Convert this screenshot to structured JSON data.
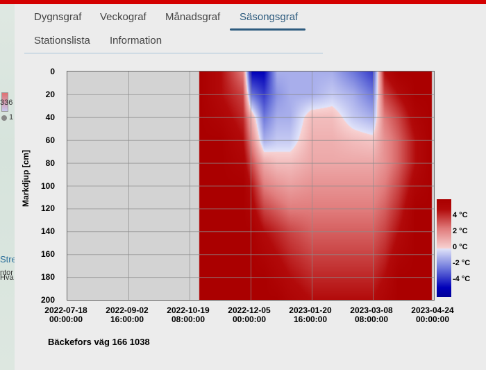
{
  "tabs": [
    {
      "label": "Dygnsgraf",
      "active": false
    },
    {
      "label": "Veckograf",
      "active": false
    },
    {
      "label": "Månadsgraf",
      "active": false
    },
    {
      "label": "Säsongsgraf",
      "active": true
    },
    {
      "label": "Stationslista",
      "active": false
    },
    {
      "label": "Information",
      "active": false
    }
  ],
  "map_fragments": {
    "value": "336",
    "count": "1",
    "place1": "Stre",
    "place2": "ntor",
    "place3": "Hva"
  },
  "colors": {
    "topbar": "#d40000",
    "active_tab": "#2d5b7e",
    "no_data": "#d3d3d3"
  },
  "station": "Bäckefors väg 166 1038",
  "chart_data": {
    "type": "heatmap",
    "ylabel": "Markdjup [cm]",
    "xlabel": "",
    "y_ticks": [
      "0",
      "20",
      "40",
      "60",
      "80",
      "100",
      "120",
      "140",
      "160",
      "180",
      "200"
    ],
    "ylim": [
      0,
      200
    ],
    "y_inverted": true,
    "x_ticks": [
      {
        "date": "2022-07-18",
        "time": "00:00:00"
      },
      {
        "date": "2022-09-02",
        "time": "16:00:00"
      },
      {
        "date": "2022-10-19",
        "time": "08:00:00"
      },
      {
        "date": "2022-12-05",
        "time": "00:00:00"
      },
      {
        "date": "2023-01-20",
        "time": "16:00:00"
      },
      {
        "date": "2023-03-08",
        "time": "08:00:00"
      },
      {
        "date": "2023-04-24",
        "time": "00:00:00"
      }
    ],
    "xlim": [
      "2022-07-18",
      "2023-04-24"
    ],
    "grid": true,
    "colorbar": {
      "ticks": [
        "4 °C",
        "2 °C",
        "0 °C",
        "-2 °C",
        "-4 °C"
      ],
      "range": [
        -5,
        5
      ],
      "placement": "right"
    },
    "depths": [
      0,
      20,
      40,
      60,
      80,
      100,
      120,
      140,
      160,
      180,
      200
    ],
    "columns": [
      {
        "date": "2022-10-27",
        "values": [
          5,
          5,
          5,
          5,
          5,
          5,
          5,
          5,
          5,
          5,
          5
        ]
      },
      {
        "date": "2022-11-12",
        "values": [
          4,
          4,
          4.5,
          5,
          5,
          5,
          5,
          5,
          5,
          5,
          5
        ]
      },
      {
        "date": "2022-11-29",
        "values": [
          2,
          3,
          3.5,
          4,
          4.5,
          5,
          5,
          5,
          5,
          5,
          5
        ]
      },
      {
        "date": "2022-12-05",
        "values": [
          -4,
          -2,
          1,
          2,
          3,
          4,
          4.5,
          5,
          5,
          5,
          5
        ]
      },
      {
        "date": "2022-12-15",
        "values": [
          -4,
          -3,
          -2,
          -1,
          1,
          2,
          3,
          4,
          4.5,
          5,
          5
        ]
      },
      {
        "date": "2022-12-25",
        "values": [
          -1,
          -1.5,
          -1,
          -0.5,
          0.5,
          1.5,
          2.5,
          3.5,
          4,
          4.5,
          5
        ]
      },
      {
        "date": "2023-01-04",
        "values": [
          -1,
          -1,
          -1,
          -0.5,
          0.5,
          1.2,
          2,
          3,
          3.5,
          4,
          4.5
        ]
      },
      {
        "date": "2023-01-20",
        "values": [
          -1,
          -1,
          0.5,
          0.8,
          1,
          1.5,
          2,
          2.5,
          3,
          3.5,
          4
        ]
      },
      {
        "date": "2023-02-05",
        "values": [
          -1,
          -0.5,
          0.5,
          0.8,
          1,
          1.5,
          2,
          2.5,
          3,
          3.5,
          4
        ]
      },
      {
        "date": "2023-02-21",
        "values": [
          -2,
          -1,
          -0.5,
          0.5,
          1,
          1.5,
          2,
          2.5,
          3,
          3.5,
          4
        ]
      },
      {
        "date": "2023-03-08",
        "values": [
          -3,
          -2,
          -1,
          0.3,
          1,
          1.5,
          2,
          2.5,
          3,
          3.5,
          4
        ]
      },
      {
        "date": "2023-03-17",
        "values": [
          4,
          3,
          2,
          1.5,
          1.5,
          2,
          2.5,
          3,
          3.5,
          4,
          4.5
        ]
      },
      {
        "date": "2023-03-28",
        "values": [
          5,
          4,
          3,
          2.5,
          2.5,
          3,
          3.5,
          4,
          4.5,
          5,
          5
        ]
      },
      {
        "date": "2023-04-10",
        "values": [
          5,
          5,
          4.5,
          4,
          4,
          4.5,
          5,
          5,
          5,
          5,
          5
        ]
      },
      {
        "date": "2023-04-22",
        "values": [
          5,
          5,
          5,
          5,
          5,
          5,
          5,
          5,
          5,
          5,
          5
        ]
      }
    ]
  }
}
